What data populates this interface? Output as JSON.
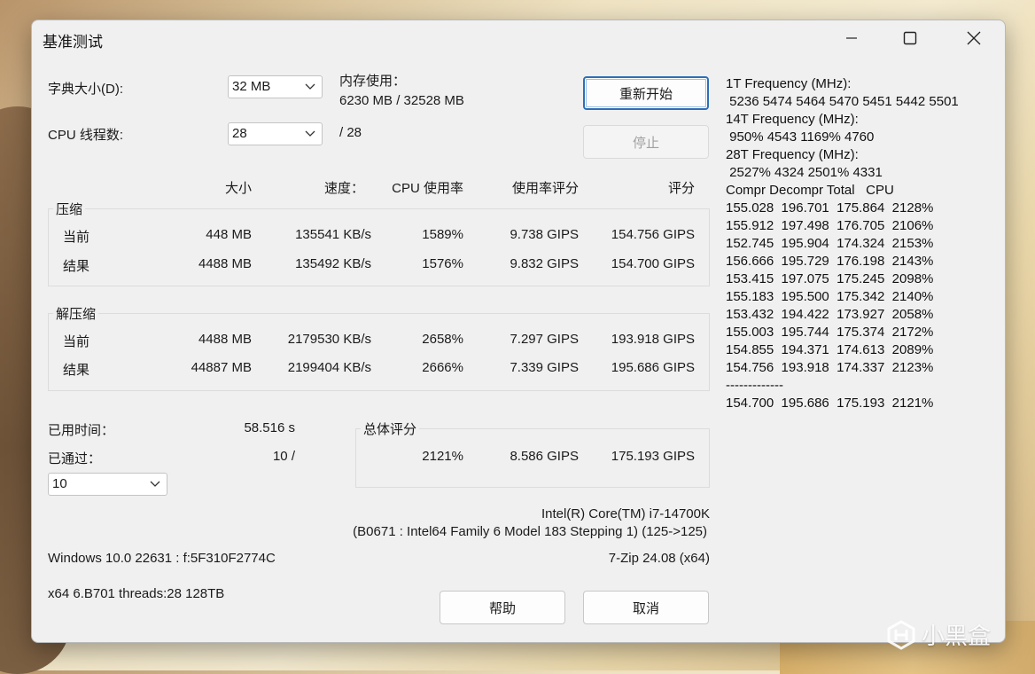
{
  "window": {
    "title": "基准测试"
  },
  "dict_size": {
    "label": "字典大小(D):",
    "value": "32 MB"
  },
  "memory": {
    "label": "内存使用：",
    "value": "6230 MB / 32528 MB"
  },
  "threads": {
    "label": "CPU 线程数:",
    "value": "28",
    "total": "/ 28"
  },
  "buttons": {
    "restart": "重新开始",
    "stop": "停止",
    "help": "帮助",
    "cancel": "取消"
  },
  "table_headers": [
    "大小",
    "速度：",
    "CPU 使用率",
    "使用率评分",
    "评分"
  ],
  "compress": {
    "title": "压缩",
    "rows": [
      {
        "label": "当前",
        "size": "448 MB",
        "speed": "135541 KB/s",
        "cpu": "1589%",
        "rating_usage": "9.738 GIPS",
        "rating": "154.756 GIPS"
      },
      {
        "label": "结果",
        "size": "4488 MB",
        "speed": "135492 KB/s",
        "cpu": "1576%",
        "rating_usage": "9.832 GIPS",
        "rating": "154.700 GIPS"
      }
    ]
  },
  "decompress": {
    "title": "解压缩",
    "rows": [
      {
        "label": "当前",
        "size": "4488 MB",
        "speed": "2179530 KB/s",
        "cpu": "2658%",
        "rating_usage": "7.297 GIPS",
        "rating": "193.918 GIPS"
      },
      {
        "label": "结果",
        "size": "44887 MB",
        "speed": "2199404 KB/s",
        "cpu": "2666%",
        "rating_usage": "7.339 GIPS",
        "rating": "195.686 GIPS"
      }
    ]
  },
  "elapsed": {
    "label": "已用时间：",
    "value": "58.516 s"
  },
  "passes": {
    "label": "已通过：",
    "value": "10 /",
    "select": "10"
  },
  "total": {
    "title": "总体评分",
    "cpu": "2121%",
    "rating_usage": "8.586 GIPS",
    "rating": "175.193 GIPS"
  },
  "cpu_info": {
    "name": "Intel(R) Core(TM) i7-14700K",
    "detail": "(B0671 : Intel64 Family 6 Model 183 Stepping 1) (125->125)"
  },
  "os": "Windows 10.0 22631 :  f:5F310F2774C",
  "version": "7-Zip 24.08 (x64)",
  "sysline": "x64 6.B701 threads:28 128TB",
  "log": [
    "1T Frequency (MHz):",
    " 5236 5474 5464 5470 5451 5442 5501",
    "14T Frequency (MHz):",
    " 950% 4543 1169% 4760",
    "28T Frequency (MHz):",
    " 2527% 4324 2501% 4331",
    "Compr Decompr Total   CPU",
    "155.028  196.701  175.864  2128%",
    "155.912  197.498  176.705  2106%",
    "152.745  195.904  174.324  2153%",
    "156.666  195.729  176.198  2143%",
    "153.415  197.075  175.245  2098%",
    "155.183  195.500  175.342  2140%",
    "153.432  194.422  173.927  2058%",
    "155.003  195.744  175.374  2172%",
    "154.855  194.371  174.613  2089%",
    "154.756  193.918  174.337  2123%",
    "-------------",
    "154.700  195.686  175.193  2121%"
  ],
  "watermark": "小黑盒"
}
